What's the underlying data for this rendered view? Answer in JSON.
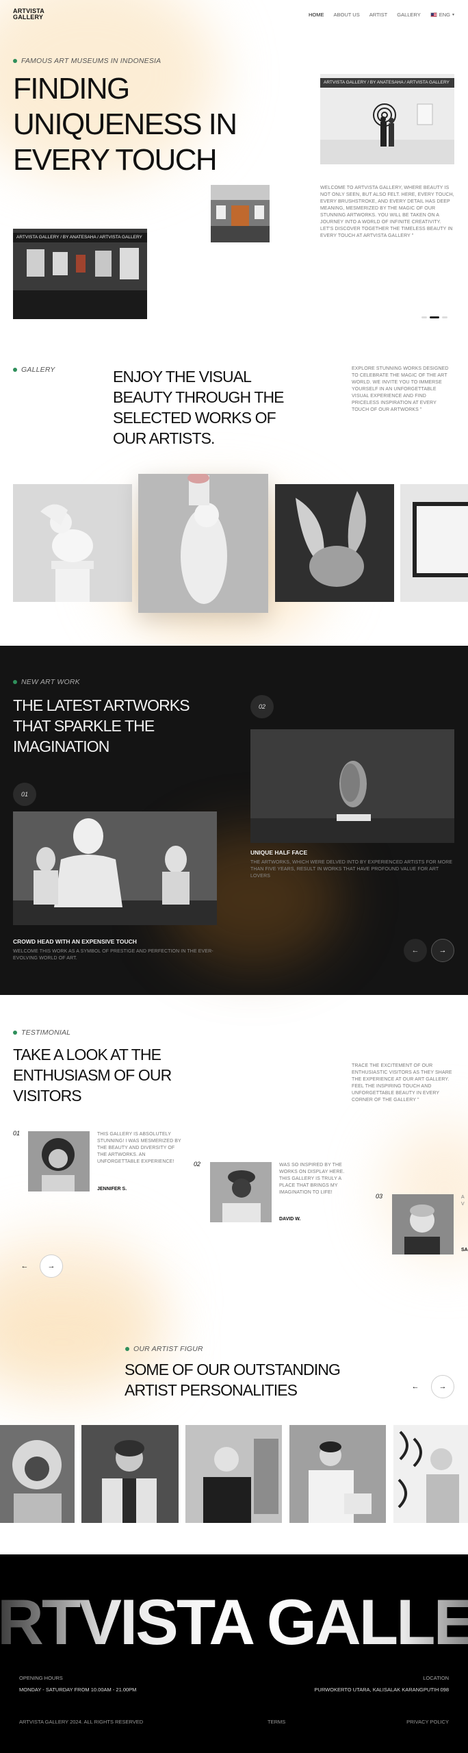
{
  "nav": {
    "logo_line1": "ARTVISTA",
    "logo_line2": "GALLERY",
    "links": [
      "HOME",
      "ABOUT US",
      "ARTIST",
      "GALLERY"
    ],
    "lang": "ENG"
  },
  "hero": {
    "eyebrow": "FAMOUS ART MUSEUMS IN INDONESIA",
    "title_lines": [
      "FINDING",
      "UNIQUENESS IN",
      "EVERY TOUCH"
    ],
    "tag_right": "ARTVISTA GALLERY / BY ANATESAHA / ARTVISTA GALLERY",
    "tag_left": "ARTVISTA GALLERY / BY ANATESAHA / ARTVISTA GALLERY",
    "description": "WELCOME TO ARTVISTA GALLERY, WHERE BEAUTY IS NOT ONLY SEEN, BUT ALSO FELT. HERE, EVERY TOUCH, EVERY BRUSHSTROKE, AND EVERY DETAIL HAS DEEP MEANING, MESMERIZED BY THE MAGIC OF OUR STUNNING ARTWORKS. YOU WILL BE TAKEN ON A JOURNEY INTO A WORLD OF INFINITE CREATIVITY. LET'S DISCOVER TOGETHER THE TIMELESS BEAUTY IN EVERY TOUCH AT ARTVISTA GALLERY \""
  },
  "gallery": {
    "eyebrow": "GALLERY",
    "title_lines": [
      "ENJOY THE VISUAL",
      "BEAUTY THROUGH THE",
      "SELECTED WORKS OF",
      "OUR ARTISTS."
    ],
    "description": "EXPLORE STUNNING WORKS DESIGNED TO CELEBRATE THE MAGIC OF THE ART WORLD. WE INVITE YOU TO IMMERSE YOURSELF IN AN UNFORGETTABLE VISUAL EXPERIENCE AND FIND PRICELESS INSPIRATION AT EVERY TOUCH OF OUR ARTWORKS \""
  },
  "new_art": {
    "eyebrow": "NEW ART WORK",
    "title_lines": [
      "THE LATEST ARTWORKS",
      "THAT SPARKLE THE",
      "IMAGINATION"
    ],
    "items": [
      {
        "num": "01",
        "title": "CROWD HEAD WITH AN EXPENSIVE TOUCH",
        "desc": "WELCOME THIS WORK AS A SYMBOL OF PRESTIGE AND PERFECTION IN THE EVER-EVOLVING WORLD OF ART."
      },
      {
        "num": "02",
        "title": "UNIQUE HALF FACE",
        "desc": "THE ARTWORKS, WHICH WERE DELVED INTO BY EXPERIENCED ARTISTS FOR MORE THAN FIVE YEARS, RESULT IN WORKS THAT HAVE PROFOUND VALUE FOR ART LOVERS"
      }
    ]
  },
  "testimonial": {
    "eyebrow": "TESTIMONIAL",
    "title_lines": [
      "TAKE A LOOK AT THE",
      "ENTHUSIASM OF OUR",
      "VISITORS"
    ],
    "description": "TRACE THE EXCITEMENT OF OUR ENTHUSIASTIC VISITORS AS THEY SHARE THE EXPERIENCE AT OUR ART GALLERY. FEEL THE INSPIRING TOUCH AND UNFORGETTABLE BEAUTY IN EVERY CORNER OF THE GALLERY \"",
    "items": [
      {
        "num": "01",
        "quote": "THIS GALLERY IS ABSOLUTELY STUNNING! I WAS MESMERIZED BY THE BEAUTY AND DIVERSITY OF THE ARTWORKS. AN UNFORGETTABLE EXPERIENCE!",
        "name": "JENNIFER S."
      },
      {
        "num": "02",
        "quote": "WAS SO INSPIRED BY THE WORKS ON DISPLAY HERE. THIS GALLERY IS TRULY A PLACE THAT BRINGS MY IMAGINATION TO LIFE!",
        "name": "DAVID W."
      },
      {
        "num": "03",
        "quote": "A V",
        "name": "SA"
      }
    ]
  },
  "artists": {
    "eyebrow": "OUR ARTIST FIGUR",
    "title_lines": [
      "SOME OF OUR OUTSTANDING",
      "ARTIST PERSONALITIES"
    ]
  },
  "footer": {
    "big_text": "RTVISTA GALLER",
    "hours_label": "OPENING HOURS",
    "hours_value": "MONDAY - SATURDAY FROM 10.00AM - 21.00PM",
    "location_label": "LOCATION",
    "location_value": "PURWOKERTO UTARA, KALISALAK KARANGPUTIH 098",
    "copyright": "ARTVISTA GALLERY 2024. ALL RIGHTS RESERVED",
    "terms": "TERMS",
    "privacy": "PRIVACY POLICY"
  },
  "colors": {
    "accent_dot": "#2f8f5b",
    "dark_bg": "#141414",
    "glow": "#f7d9a8"
  },
  "icons": {
    "prev": "arrow-left-icon",
    "next": "arrow-right-icon"
  },
  "arrows": {
    "prev": "←",
    "next": "→"
  }
}
